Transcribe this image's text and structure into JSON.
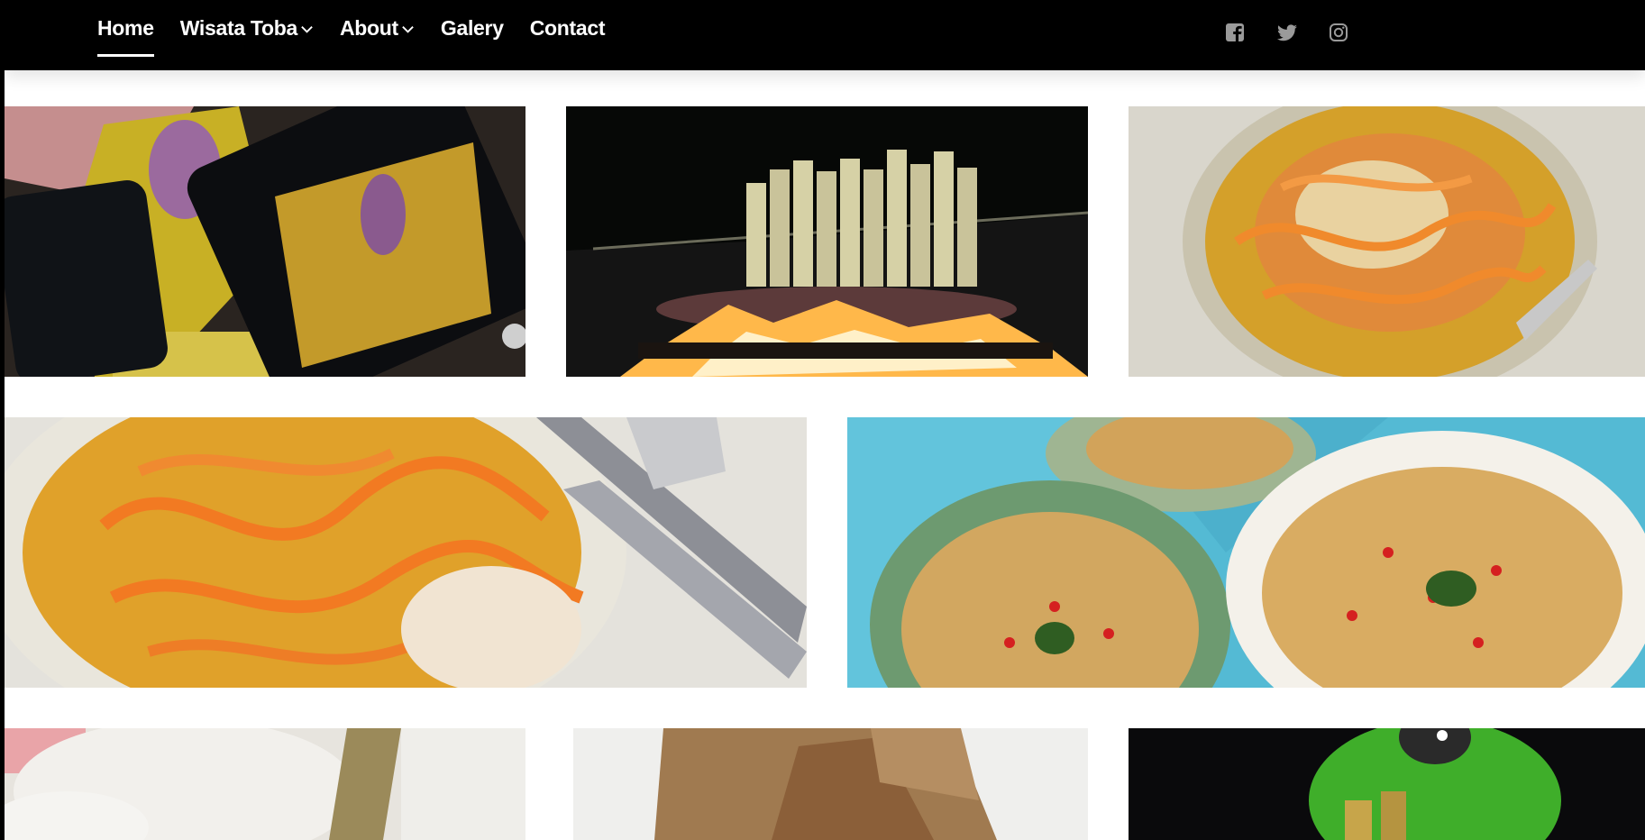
{
  "nav": {
    "home": "Home",
    "wisata_toba": "Wisata Toba",
    "about": "About",
    "galery": "Galery",
    "contact": "Contact"
  },
  "social_icons": [
    "facebook-icon",
    "twitter-icon",
    "instagram-icon"
  ],
  "colors": {
    "navbar": "#000000",
    "nav_text": "#ffffff",
    "social_icon": "#9a9a9a",
    "background": "#ffffff"
  }
}
